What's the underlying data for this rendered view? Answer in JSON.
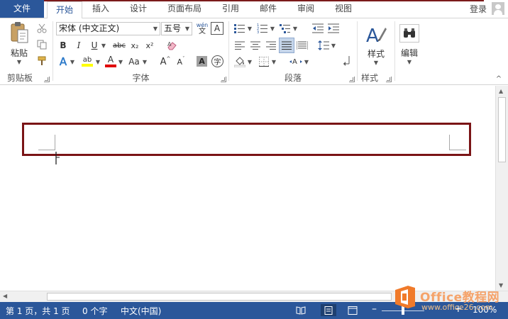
{
  "tabs": {
    "file": "文件",
    "items": [
      "开始",
      "插入",
      "设计",
      "页面布局",
      "引用",
      "邮件",
      "审阅",
      "视图"
    ],
    "active": "开始",
    "login": "登录"
  },
  "ribbon": {
    "clipboard": {
      "label": "剪贴板",
      "paste": "粘贴"
    },
    "font": {
      "label": "字体",
      "font_name": "宋体 (中文正文)",
      "font_size": "五号",
      "wen_top": "wén",
      "wen_bottom": "文",
      "char_border": "A",
      "bold": "B",
      "italic": "I",
      "underline": "U",
      "strike": "abc",
      "subscript": "x₂",
      "superscript": "x²",
      "text_effect": "A",
      "highlight": "ab",
      "font_color": "A",
      "change_case": "Aa",
      "grow": "A",
      "shrink": "A",
      "shading": "A",
      "enclose": "字"
    },
    "paragraph": {
      "label": "段落"
    },
    "styles": {
      "label": "样式",
      "button": "样式"
    },
    "editing": {
      "button": "编辑"
    }
  },
  "status": {
    "page": "第 1 页，共 1 页",
    "words": "0 个字",
    "language": "中文(中国)",
    "zoom": "100%"
  },
  "watermark": {
    "title": "Office教程网",
    "url": "www.office26.com"
  },
  "colors": {
    "accent": "#2b579a",
    "highlight_box": "#7a1416",
    "watermark": "#f07a2a"
  }
}
